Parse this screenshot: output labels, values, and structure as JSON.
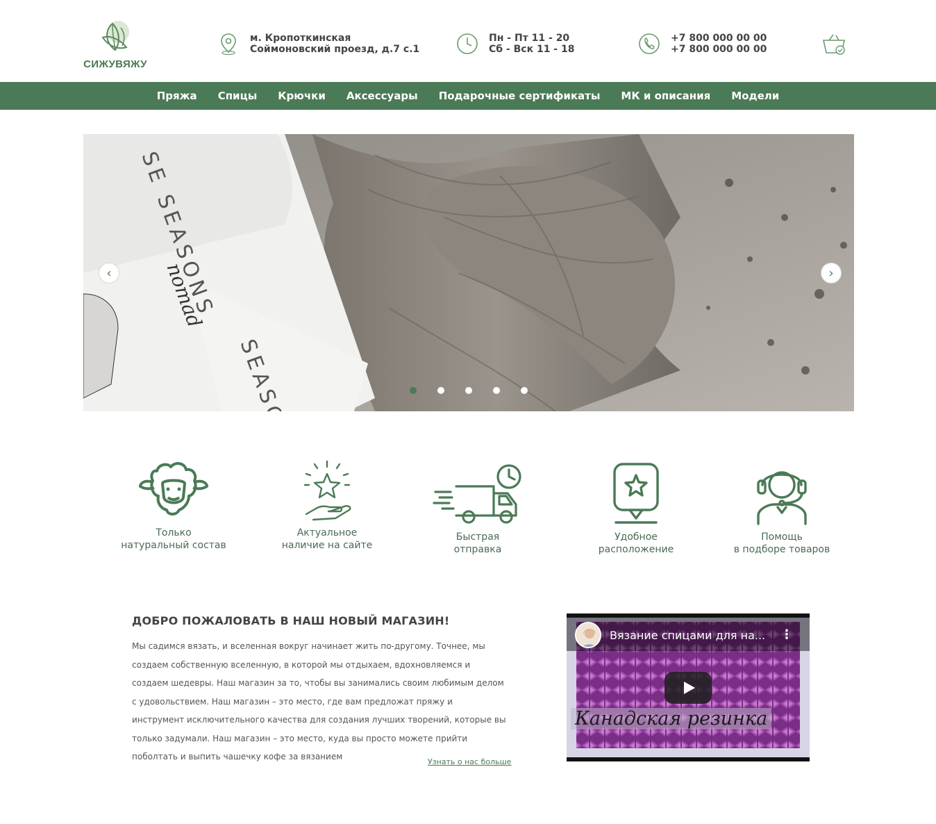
{
  "brand": {
    "name": "СИЖУВЯЖУ",
    "accent": "#4a7a56"
  },
  "header": {
    "address": {
      "line1": "м. Кропоткинская",
      "line2": "Соймоновский проезд, д.7 с.1",
      "icon": "map-pin-icon"
    },
    "hours": {
      "line1": "Пн - Пт 11 - 20",
      "line2": "Сб - Вск 11 - 18",
      "icon": "clock-icon"
    },
    "phone": {
      "line1": "+7 800 000 00 00",
      "line2": "+7 800 000 00 00",
      "icon": "phone-icon"
    },
    "cart_icon": "cart-icon"
  },
  "nav": {
    "items": [
      "Пряжа",
      "Спицы",
      "Крючки",
      "Аксессуары",
      "Подарочные сертификаты",
      "МК и описания",
      "Модели"
    ]
  },
  "slider": {
    "slide_text_1": "SE SEASONS",
    "slide_text_2": "SEASO",
    "slide_script": "nomad",
    "prev_glyph": "‹",
    "next_glyph": "›",
    "slide_count": 5,
    "active_slide": 1
  },
  "features": [
    {
      "icon": "sheep-icon",
      "line1": "Только",
      "line2": "натуральный состав"
    },
    {
      "icon": "star-hand-icon",
      "line1": "Актуальное",
      "line2": "наличие на сайте"
    },
    {
      "icon": "delivery-truck-icon",
      "line1": "Быстрая",
      "line2": "отправка"
    },
    {
      "icon": "location-star-icon",
      "line1": "Удобное",
      "line2": "расположение"
    },
    {
      "icon": "support-headset-icon",
      "line1": "Помощь",
      "line2": "в подборе товаров"
    }
  ],
  "welcome": {
    "title": "ДОБРО ПОЖАЛОВАТЬ В НАШ НОВЫЙ МАГАЗИН!",
    "text": "Мы садимся вязать, и вселенная вокруг начинает жить по-другому. Точнее, мы создаем собственную вселенную, в которой мы отдыхаем, вдохновляемся и создаем шедевры. Наш магазин за то, чтобы вы занимались своим любимым делом с удовольствием. Наш магазин – это место, где вам предложат пряжу и инструмент исключительного качества для создания лучших творений, которые вы только задумали. Наш магазин – это место, куда вы просто можете прийти поболтать и выпить чашечку кофе за вязанием",
    "more_link": "Узнать о нас больше"
  },
  "video": {
    "title": "Вязание спицами для на...",
    "caption": "Канадская резинка",
    "menu_glyph": "⋮"
  }
}
